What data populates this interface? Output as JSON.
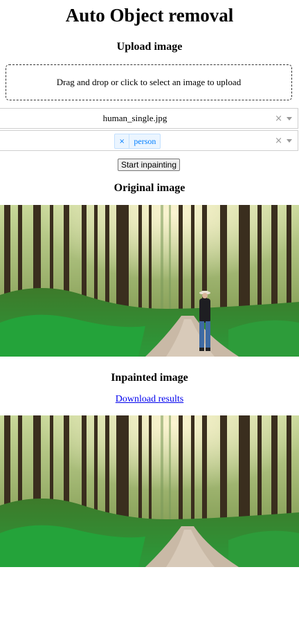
{
  "app": {
    "title": "Auto Object removal"
  },
  "upload": {
    "heading": "Upload image",
    "dropzone_text": "Drag and drop or click to select an image to upload"
  },
  "file_select": {
    "value": "human_single.jpg",
    "clear_glyph": "×"
  },
  "class_select": {
    "tags": [
      {
        "remove_glyph": "×",
        "label": "person"
      }
    ],
    "clear_glyph": "×"
  },
  "actions": {
    "start_label": "Start inpainting"
  },
  "original": {
    "heading": "Original image",
    "icon": "forest-path-with-person-image"
  },
  "inpainted": {
    "heading": "Inpainted image",
    "download_label": "Download results",
    "icon": "forest-path-image"
  },
  "colors": {
    "link": "#0000ee",
    "tag_background": "#ebf5ff",
    "tag_text": "#007eff"
  }
}
